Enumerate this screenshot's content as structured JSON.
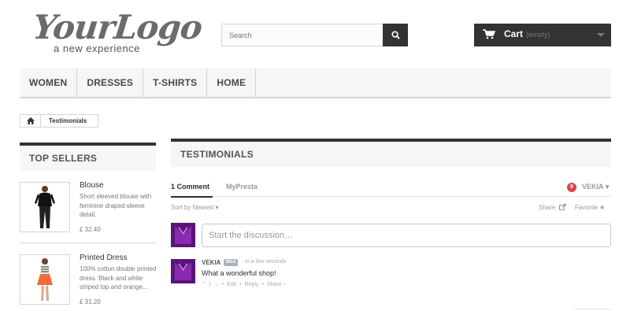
{
  "header": {
    "logo_main": "YourLogo",
    "logo_tagline": "a new experience",
    "search_placeholder": "Search",
    "cart_title": "Cart",
    "cart_status": "(empty)"
  },
  "nav": {
    "items": [
      "WOMEN",
      "DRESSES",
      "T-SHIRTS",
      "HOME"
    ]
  },
  "breadcrumb": {
    "current": "Testimonials"
  },
  "sidebar": {
    "title": "TOP SELLERS",
    "products": [
      {
        "name": "Blouse",
        "description": "Short sleeved blouse with feminine draped sleeve detail.",
        "price": "£ 32.40"
      },
      {
        "name": "Printed Dress",
        "description": "100% cotton double printed dress. Black and white striped top and orange...",
        "price": "£ 31.20"
      }
    ]
  },
  "main": {
    "title": "TESTIMONIALS",
    "comments_tab": "1 Comment",
    "community_tab": "MyPresta",
    "notification_count": "9",
    "user_name": "VEKIA",
    "sort_label": "Sort by Newest",
    "share_label": "Share",
    "favorite_label": "Favorite",
    "compose_placeholder": "Start the discussion…",
    "comment": {
      "author": "VEKIA",
      "badge": "Mod",
      "time": "in a few seconds",
      "text": "What a wonderful shop!",
      "actions": {
        "edit": "Edit",
        "reply": "Reply",
        "share": "Share ›"
      }
    }
  },
  "colors": {
    "dark": "#333333",
    "nav_bg": "#f6f6f6",
    "border": "#d6d4d4",
    "notif": "#e0444b",
    "avatar": "#6a1b8a"
  }
}
